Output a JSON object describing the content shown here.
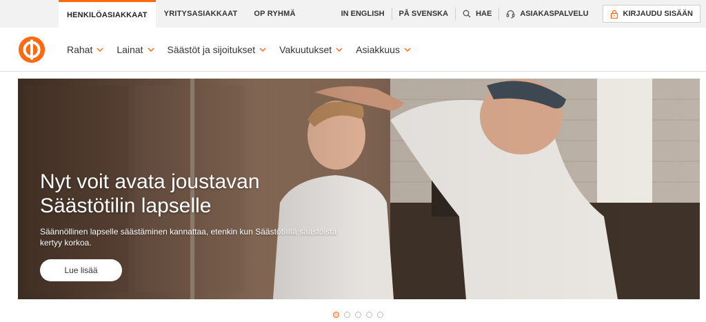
{
  "topbar": {
    "segments": [
      {
        "label": "HENKILÖASIAKKAAT",
        "active": true
      },
      {
        "label": "YRITYSASIAKKAAT",
        "active": false
      },
      {
        "label": "OP RYHMÄ",
        "active": false
      }
    ],
    "links": {
      "english": "IN ENGLISH",
      "swedish": "PÅ SVENSKA",
      "search": "HAE",
      "support": "ASIAKASPALVELU",
      "login": "KIRJAUDU SISÄÄN"
    }
  },
  "nav": {
    "items": [
      "Rahat",
      "Lainat",
      "Säästöt ja sijoitukset",
      "Vakuutukset",
      "Asiakkuus"
    ]
  },
  "hero": {
    "title": "Nyt voit avata joustavan Säästötilin lapselle",
    "text": "Säännöllinen lapselle säästäminen kannattaa, etenkin kun Säästötilillä säästöistä kertyy korkoa.",
    "button": "Lue lisää"
  },
  "carousel": {
    "slides": 5,
    "active": 1
  },
  "colors": {
    "brand": "#ff6a10"
  },
  "icons": {
    "search": "search-icon",
    "support": "headset-icon",
    "login": "lock-icon",
    "chevron": "chevron-down-icon"
  }
}
